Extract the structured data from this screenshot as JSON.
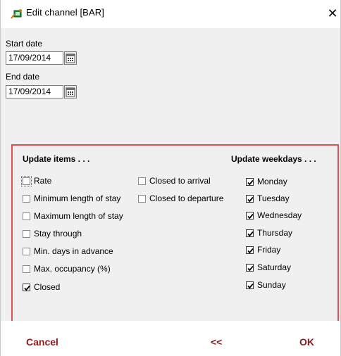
{
  "window": {
    "title": "Edit channel [BAR]",
    "close_glyph": "✕"
  },
  "dates": {
    "start_label": "Start date",
    "start_value": "17/09/2014",
    "end_label": "End date",
    "end_value": "17/09/2014"
  },
  "update_items": {
    "title": "Update items . . .",
    "col1": [
      {
        "label": "Rate",
        "checked": false
      },
      {
        "label": "Minimum length of stay",
        "checked": false
      },
      {
        "label": "Maximum length of stay",
        "checked": false
      },
      {
        "label": "Stay through",
        "checked": false
      },
      {
        "label": "Min. days in advance",
        "checked": false
      },
      {
        "label": "Max. occupancy (%)",
        "checked": false
      },
      {
        "label": "Closed",
        "checked": true
      }
    ],
    "col2": [
      {
        "label": "Closed to arrival",
        "checked": false
      },
      {
        "label": "Closed to departure",
        "checked": false
      }
    ]
  },
  "update_weekdays": {
    "title": "Update weekdays . . .",
    "days": [
      {
        "label": "Monday",
        "checked": true
      },
      {
        "label": "Tuesday",
        "checked": true
      },
      {
        "label": "Wednesday",
        "checked": true
      },
      {
        "label": "Thursday",
        "checked": true
      },
      {
        "label": "Friday",
        "checked": true
      },
      {
        "label": "Saturday",
        "checked": true
      },
      {
        "label": "Sunday",
        "checked": true
      }
    ]
  },
  "footer": {
    "cancel_label": "Cancel",
    "back_label": "<<",
    "ok_label": "OK"
  },
  "colors": {
    "panel_border": "#e05050",
    "footer_text": "#8b1a1a",
    "content_bg": "#f0f0f0"
  }
}
